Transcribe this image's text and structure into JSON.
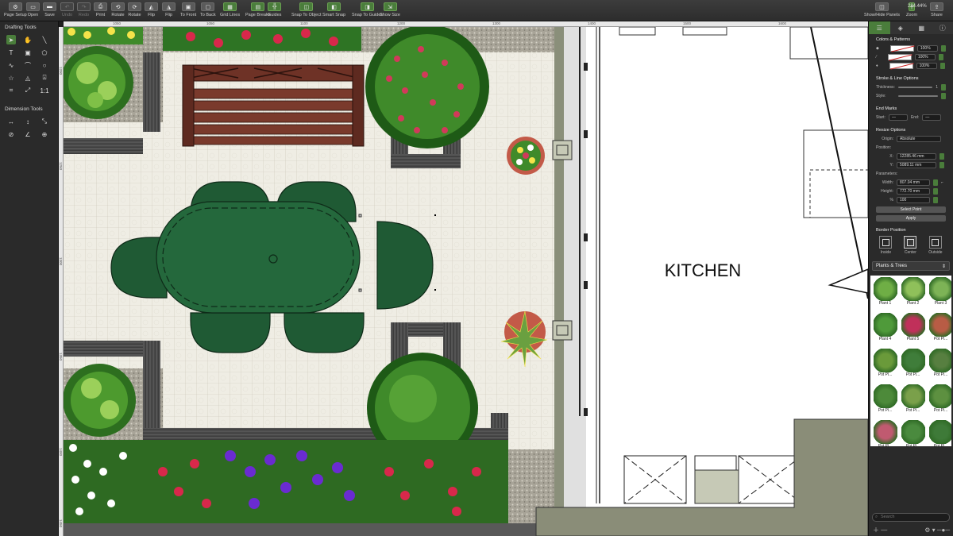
{
  "toolbar": {
    "items": [
      {
        "label": "Page Setup",
        "icon": "gear-icon",
        "glyph": "⚙"
      },
      {
        "label": "Open",
        "icon": "open-icon",
        "glyph": "▭"
      },
      {
        "label": "Save",
        "icon": "save-icon",
        "glyph": "▬"
      },
      {
        "label": "Undo",
        "icon": "undo-icon",
        "glyph": "↶",
        "disabled": true
      },
      {
        "label": "Redo",
        "icon": "redo-icon",
        "glyph": "↷",
        "disabled": true
      },
      {
        "label": "Print",
        "icon": "print-icon",
        "glyph": "⎙"
      },
      {
        "label": "Rotate",
        "icon": "rotate-left-icon",
        "glyph": "⟲"
      },
      {
        "label": "Rotate",
        "icon": "rotate-right-icon",
        "glyph": "⟳"
      },
      {
        "label": "Flip",
        "icon": "flip-horizontal-icon",
        "glyph": "◭"
      },
      {
        "label": "Flip",
        "icon": "flip-vertical-icon",
        "glyph": "◮"
      },
      {
        "label": "To Front",
        "icon": "to-front-icon",
        "glyph": "▣"
      },
      {
        "label": "To Back",
        "icon": "to-back-icon",
        "glyph": "▢"
      },
      {
        "label": "Grid Lines",
        "icon": "grid-icon",
        "glyph": "▦",
        "green": true
      },
      {
        "label": "Page Breaks",
        "icon": "page-breaks-icon",
        "glyph": "▤",
        "green": true
      },
      {
        "label": "Guides",
        "icon": "guides-icon",
        "glyph": "╬",
        "green": true
      },
      {
        "label": "Snap To Object",
        "icon": "snap-object-icon",
        "glyph": "◫",
        "green": true
      },
      {
        "label": "Smart Snap",
        "icon": "smart-snap-icon",
        "glyph": "◧",
        "green": true
      },
      {
        "label": "Snap To Guides",
        "icon": "snap-guides-icon",
        "glyph": "◨",
        "green": true
      },
      {
        "label": "Show Size",
        "icon": "show-size-icon",
        "glyph": "⇲",
        "green": true
      }
    ],
    "right": [
      {
        "label": "Show/Hide Panels",
        "icon": "panels-icon",
        "glyph": "◫"
      },
      {
        "label": "Zoom",
        "icon": "zoom-icon",
        "glyph": "＋"
      },
      {
        "label": "Share",
        "icon": "share-icon",
        "glyph": "⇪"
      }
    ],
    "zoom_value": "284.44%"
  },
  "left_panel": {
    "drafting_title": "Drafting Tools",
    "drafting_tools": [
      "pointer",
      "hand",
      "line",
      "rectangle",
      "text",
      "image",
      "polygon",
      "polyline",
      "curve",
      "bezier",
      "circle",
      "heart",
      "star",
      "flame",
      "stamp",
      "eyedropper",
      "crop",
      "scale",
      "ratio",
      "arc"
    ],
    "dimension_title": "Dimension Tools",
    "dimension_tools": [
      "horizontal",
      "vertical",
      "diagonal",
      "radius",
      "diameter",
      "angle",
      "point",
      "triangle"
    ],
    "scale_label": "1:1"
  },
  "ruler": {
    "top_marks": [
      "1050",
      "1050",
      "1100",
      "1200",
      "1300",
      "1400",
      "1500",
      "1600"
    ],
    "left_marks": [
      "1200",
      "1250",
      "1300",
      "1350",
      "1400",
      "1450"
    ]
  },
  "canvas": {
    "room_label": "KITCHEN"
  },
  "right_panel": {
    "colors_title": "Colors & Patterns",
    "fill_pct": "100%",
    "line_pct": "100%",
    "shadow_pct": "100%",
    "stroke_title": "Stroke & Line Options",
    "thickness_label": "Thickness:",
    "thickness_value": "1",
    "style_label": "Style:",
    "end_marks_title": "End Marks",
    "start_label": "Start:",
    "end_label": "End:",
    "resize_title": "Resize Options",
    "origin_label": "Origin:",
    "origin_value": "Absolute",
    "position_label": "Position:",
    "x_label": "X:",
    "x_value": "12285.46 mm",
    "y_label": "Y:",
    "y_value": "5089.11 mm",
    "parameters_label": "Parameters:",
    "width_label": "Width:",
    "width_value": "807.04 mm",
    "height_label": "Height:",
    "height_value": "772.70 mm",
    "pct_label": "%",
    "pct_value": "100",
    "select_point": "Select Point",
    "apply": "Apply",
    "border_title": "Border Position",
    "border_inside": "Inside",
    "border_center": "Center",
    "border_outside": "Outside",
    "category": "Plants & Trees",
    "library": [
      {
        "label": "Plant 1",
        "color": "#6fae45"
      },
      {
        "label": "Plant 2",
        "color": "#8fc05a"
      },
      {
        "label": "Plant 3",
        "color": "#7db356"
      },
      {
        "label": "Plant 4",
        "color": "#4f9a3a"
      },
      {
        "label": "Plant 5",
        "color": "#c0305a"
      },
      {
        "label": "Pot Pl...",
        "color": "#b85c45"
      },
      {
        "label": "Pot Pl...",
        "color": "#6a9a3a"
      },
      {
        "label": "Pot Pl...",
        "color": "#3f7d3a"
      },
      {
        "label": "Pot Pl...",
        "color": "#577f40"
      },
      {
        "label": "Pot Pl...",
        "color": "#4d8a3a"
      },
      {
        "label": "Pot Pl...",
        "color": "#7aa04a"
      },
      {
        "label": "Pot Pl...",
        "color": "#5d9040"
      },
      {
        "label": "Pot Pl...",
        "color": "#c05a70"
      },
      {
        "label": "Pot Pl...",
        "color": "#4a8a3e"
      },
      {
        "label": "Pot Pl...",
        "color": "#3e7a38"
      }
    ],
    "search_placeholder": "Search"
  }
}
